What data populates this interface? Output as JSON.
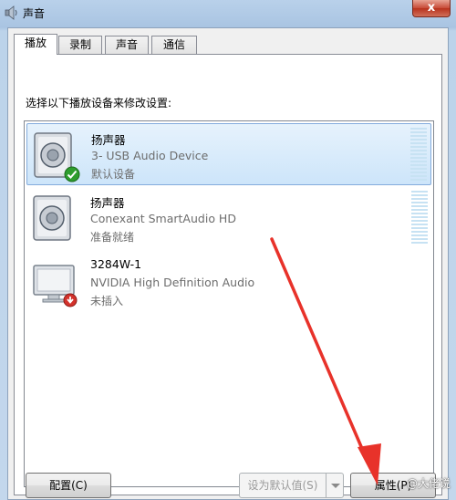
{
  "window": {
    "title": "声音",
    "close_glyph": "x"
  },
  "tabs": [
    {
      "label": "播放"
    },
    {
      "label": "录制"
    },
    {
      "label": "声音"
    },
    {
      "label": "通信"
    }
  ],
  "instruction": "选择以下播放设备来修改设置:",
  "devices": [
    {
      "name": "扬声器",
      "description": "3- USB Audio Device",
      "status": "默认设备",
      "icon": "speaker-icon",
      "badge": "check-badge-icon"
    },
    {
      "name": "扬声器",
      "description": "Conexant SmartAudio HD",
      "status": "准备就绪",
      "icon": "speaker-icon"
    },
    {
      "name": "3284W-1",
      "description": "NVIDIA High Definition Audio",
      "status": "未插入",
      "icon": "monitor-icon",
      "badge": "unplugged-badge-icon"
    }
  ],
  "buttons": {
    "configure": "配置(C)",
    "set_default": "设为默认值(S)",
    "properties": "属性(P)"
  },
  "watermark": "@大佬说",
  "colors": {
    "selection": "#cde5fa",
    "annotation_arrow": "#e8322a",
    "check_green": "#2e9d2e"
  }
}
